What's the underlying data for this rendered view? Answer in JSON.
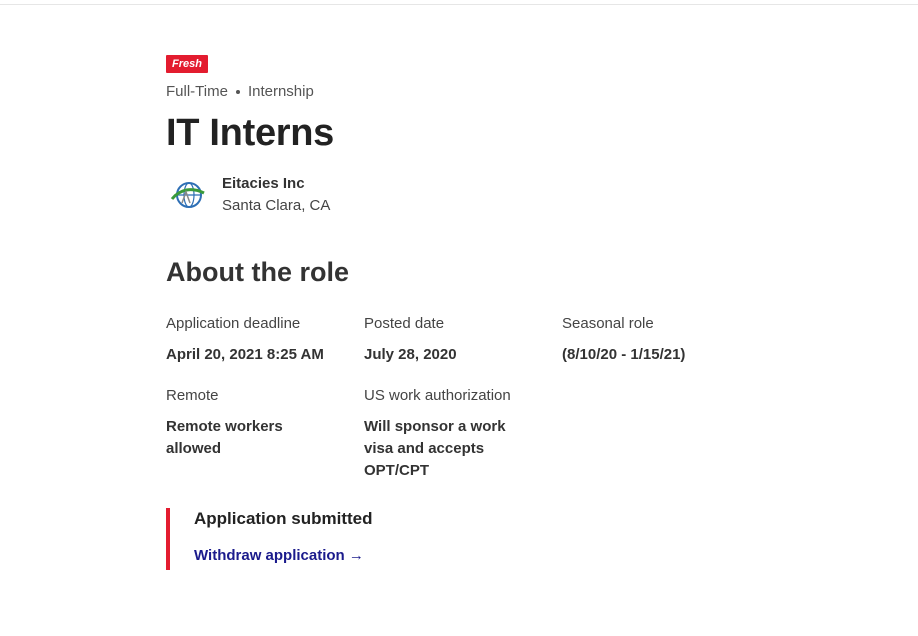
{
  "badge": "Fresh",
  "job_types": [
    "Full-Time",
    "Internship"
  ],
  "title": "IT Interns",
  "employer": {
    "name": "Eitacies Inc",
    "location": "Santa Clara, CA"
  },
  "about": {
    "heading": "About the role",
    "fields": [
      {
        "label": "Application deadline",
        "value": "April 20, 2021 8:25 AM"
      },
      {
        "label": "Posted date",
        "value": "July 28, 2020"
      },
      {
        "label": "Seasonal role",
        "value": "(8/10/20 - 1/15/21)"
      },
      {
        "label": "Remote",
        "value": "Remote workers allowed"
      },
      {
        "label": "US work authorization",
        "value": "Will sponsor a work visa and accepts OPT/CPT"
      }
    ]
  },
  "application": {
    "status": "Application submitted",
    "withdraw_label": "Withdraw application →"
  },
  "colors": {
    "accent_red": "#e31c2f",
    "link_blue": "#1b1b8c"
  },
  "icons": {
    "employer_logo": "globe-logo-icon"
  }
}
